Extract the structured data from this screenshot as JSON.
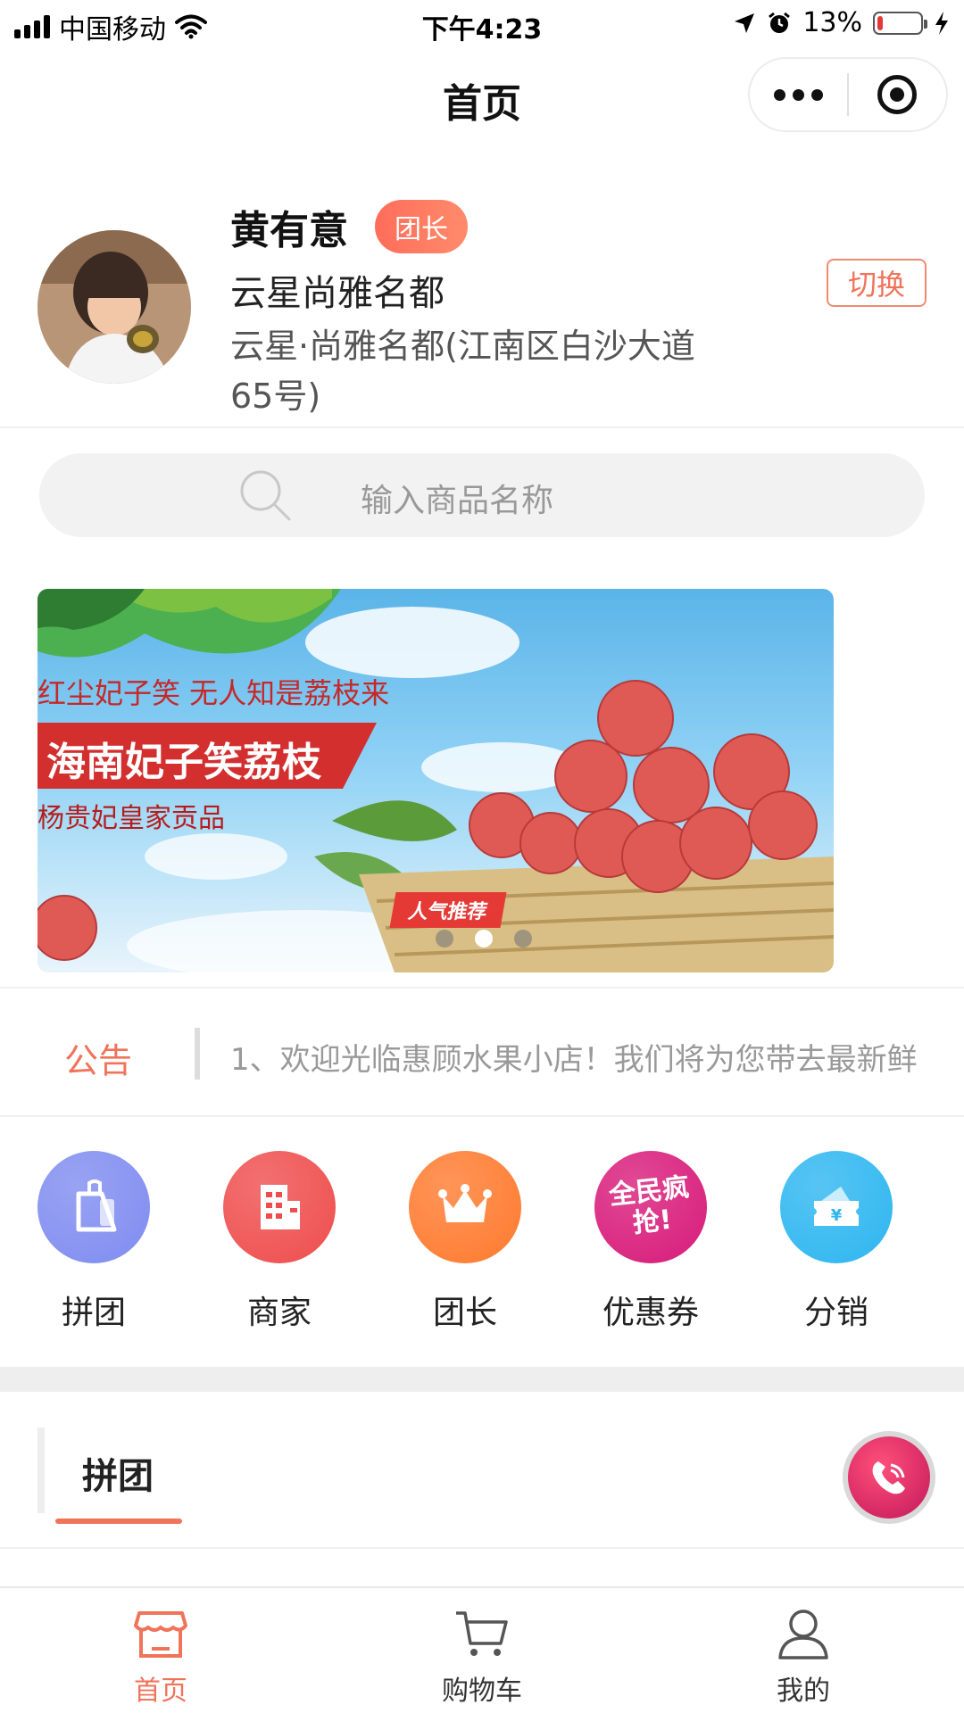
{
  "status_bar": {
    "carrier": "中国移动",
    "time": "下午4:23",
    "battery": "13%",
    "battery_level": 0.13
  },
  "nav": {
    "title": "首页"
  },
  "profile": {
    "name": "黄有意",
    "badge": "团长",
    "community": "云星尚雅名都",
    "address": "云星·尚雅名都(江南区白沙大道65号)",
    "switch_label": "切换"
  },
  "search": {
    "placeholder": "输入商品名称"
  },
  "banner": {
    "line1": "红尘妃子笑  无人知是荔枝来",
    "line2": "海南妃子笑荔枝",
    "line3": "杨贵妃皇家贡品",
    "tag": "人气推荐",
    "slide_count": 3,
    "active_slide": 2
  },
  "notice": {
    "label": "公告",
    "text": "1、欢迎光临惠顾水果小店！我们将为您带去最新鲜"
  },
  "grid": [
    {
      "label": "拼团",
      "icon": "group-buy-tag-icon",
      "color": "#7f8cf0"
    },
    {
      "label": "商家",
      "icon": "merchant-building-icon",
      "color": "#ef4d4d"
    },
    {
      "label": "团长",
      "icon": "crown-icon",
      "color": "#ff7a2e"
    },
    {
      "label": "优惠券",
      "icon": "flash-sale-icon",
      "color": "#d81b7a",
      "icon_text": "全民疯抢!"
    },
    {
      "label": "分销",
      "icon": "ticket-yen-icon",
      "color": "#2db6f0"
    }
  ],
  "section": {
    "title": "拼团"
  },
  "tabbar": {
    "items": [
      {
        "label": "首页",
        "icon": "store-icon",
        "active": true
      },
      {
        "label": "购物车",
        "icon": "cart-icon",
        "active": false
      },
      {
        "label": "我的",
        "icon": "user-icon",
        "active": false
      }
    ],
    "active_color": "#f0735a",
    "inactive_color": "#333333"
  }
}
